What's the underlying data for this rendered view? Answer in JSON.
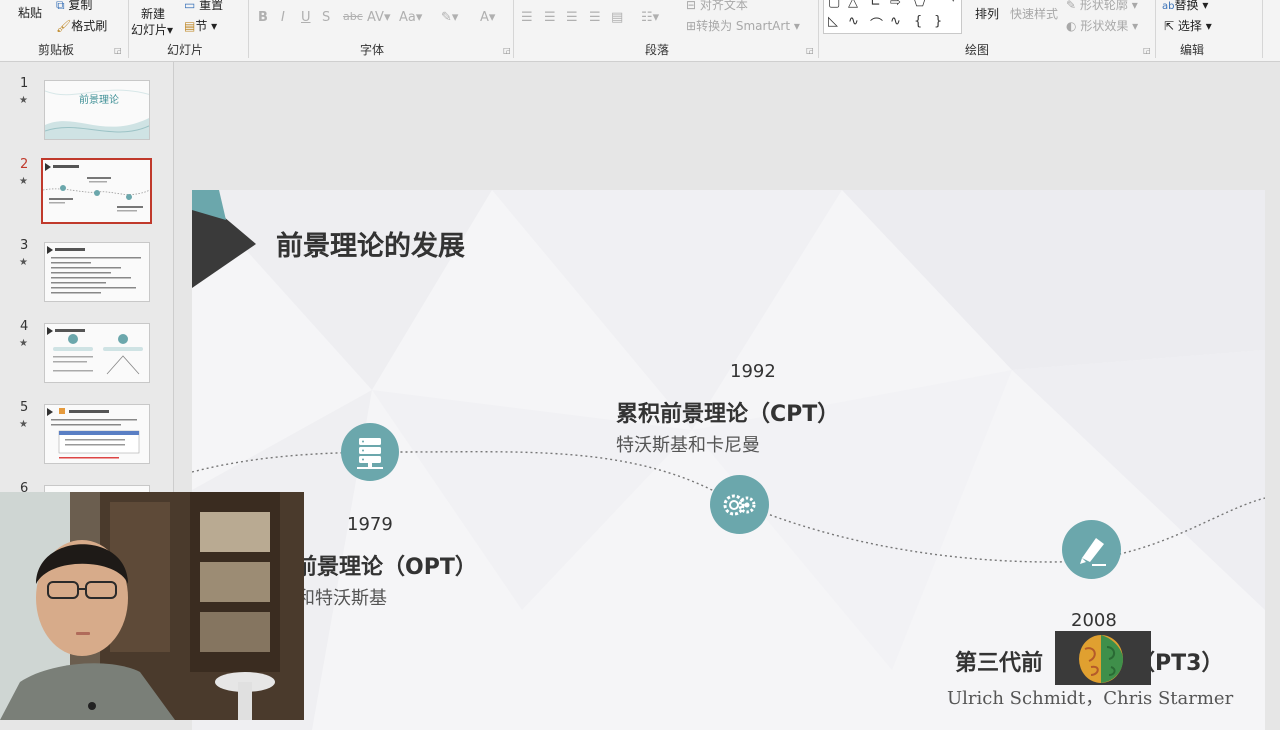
{
  "ribbon": {
    "clipboard": {
      "paste": "粘贴",
      "copy": "复制",
      "format_painter": "格式刷",
      "group": "剪贴板"
    },
    "slides": {
      "new_slide": "新建",
      "new_slide_2": "幻灯片",
      "reset": "重置",
      "section": "节",
      "group": "幻灯片"
    },
    "font": {
      "group": "字体",
      "case_btn": "Aa"
    },
    "paragraph": {
      "text_align": "对齐文本",
      "smartart": "转换为 SmartArt",
      "group": "段落"
    },
    "drawing": {
      "arrange": "排列",
      "quick_styles": "快速样式",
      "shape_outline": "形状轮廓",
      "shape_effects": "形状效果",
      "group": "绘图"
    },
    "editing": {
      "replace": "替换",
      "select": "选择",
      "group": "编辑"
    }
  },
  "thumbnails": [
    {
      "num": "1",
      "star": "★",
      "label": "前景理论"
    },
    {
      "num": "2",
      "star": "★"
    },
    {
      "num": "3",
      "star": "★"
    },
    {
      "num": "4",
      "star": "★"
    },
    {
      "num": "5",
      "star": "★"
    },
    {
      "num": "6"
    }
  ],
  "slide": {
    "title": "前景理论的发展",
    "milestones": [
      {
        "year": "1979",
        "title": "前景理论（OPT）",
        "authors": "和特沃斯基"
      },
      {
        "year": "1992",
        "title": "累积前景理论（CPT）",
        "authors": "特沃斯基和卡尼曼"
      },
      {
        "year": "2008",
        "title_start": "第三代前",
        "title_end": "（PT3）",
        "authors": "Ulrich Schmidt，Chris Starmer"
      }
    ]
  },
  "colors": {
    "accent": "#6ba7ac",
    "selected_thumb": "#c0392b",
    "title_triangle": "#3a3a3a"
  }
}
